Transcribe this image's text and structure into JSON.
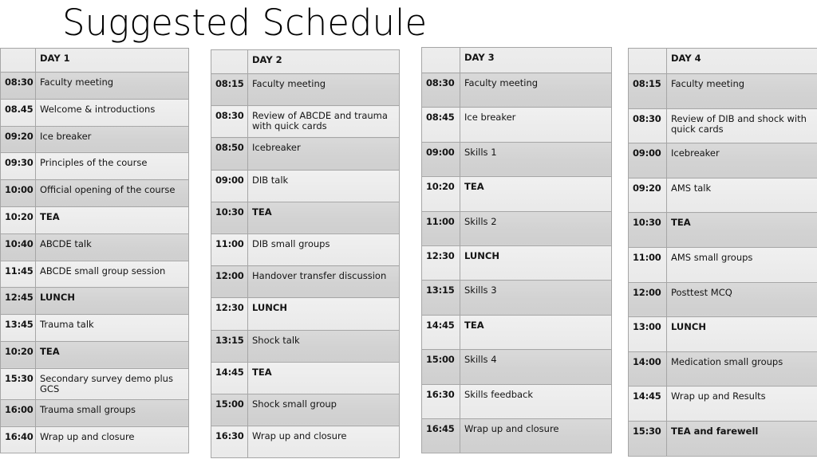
{
  "slide": {
    "title": "Suggested Schedule",
    "background_color": "#ffffff",
    "border_color": "#a6a6a6",
    "row_shade_dark": "#d9d9d9",
    "row_shade_light": "#f0f0f0"
  },
  "tables": [
    {
      "header_time": "",
      "header_day": "DAY 1",
      "rows": [
        {
          "time": "08:30",
          "activity": "Faculty meeting",
          "bold": false
        },
        {
          "time": "08.45",
          "activity": "Welcome & introductions",
          "bold": false
        },
        {
          "time": "09:20",
          "activity": "Ice breaker",
          "bold": false
        },
        {
          "time": "09:30",
          "activity": "Principles of the course",
          "bold": false
        },
        {
          "time": "10:00",
          "activity": "Official opening of the course",
          "bold": false
        },
        {
          "time": "10:20",
          "activity": "TEA",
          "bold": true
        },
        {
          "time": "10:40",
          "activity": "ABCDE talk",
          "bold": false
        },
        {
          "time": "11:45",
          "activity": "ABCDE small group session",
          "bold": false
        },
        {
          "time": "12:45",
          "activity": "LUNCH",
          "bold": true
        },
        {
          "time": "13:45",
          "activity": "Trauma talk",
          "bold": false
        },
        {
          "time": "10:20",
          "activity": "TEA",
          "bold": true
        },
        {
          "time": "15:30",
          "activity": "Secondary survey demo plus GCS",
          "bold": false
        },
        {
          "time": "16:00",
          "activity": "Trauma small groups",
          "bold": false
        },
        {
          "time": "16:40",
          "activity": "Wrap up and closure",
          "bold": false
        }
      ]
    },
    {
      "header_time": "",
      "header_day": "DAY 2",
      "rows": [
        {
          "time": "08:15",
          "activity": "Faculty meeting",
          "bold": false
        },
        {
          "time": "08:30",
          "activity": "Review of ABCDE and trauma with quick cards",
          "bold": false
        },
        {
          "time": "08:50",
          "activity": "Icebreaker",
          "bold": false
        },
        {
          "time": "09:00",
          "activity": "DIB talk",
          "bold": false
        },
        {
          "time": "10:30",
          "activity": "TEA",
          "bold": true
        },
        {
          "time": "11:00",
          "activity": "DIB small groups",
          "bold": false
        },
        {
          "time": "12:00",
          "activity": "Handover transfer discussion",
          "bold": false
        },
        {
          "time": "12:30",
          "activity": "LUNCH",
          "bold": true
        },
        {
          "time": "13:15",
          "activity": "Shock talk",
          "bold": false
        },
        {
          "time": "14:45",
          "activity": "TEA",
          "bold": true
        },
        {
          "time": "15:00",
          "activity": "Shock small group",
          "bold": false
        },
        {
          "time": "16:30",
          "activity": "Wrap up and closure",
          "bold": false
        }
      ]
    },
    {
      "header_time": "",
      "header_day": "DAY 3",
      "rows": [
        {
          "time": "08:30",
          "activity": "Faculty meeting",
          "bold": false
        },
        {
          "time": "08:45",
          "activity": "Ice breaker",
          "bold": false
        },
        {
          "time": "09:00",
          "activity": "Skills 1",
          "bold": false
        },
        {
          "time": "10:20",
          "activity": "TEA",
          "bold": true
        },
        {
          "time": "11:00",
          "activity": "Skills 2",
          "bold": false
        },
        {
          "time": "12:30",
          "activity": "LUNCH",
          "bold": true
        },
        {
          "time": "13:15",
          "activity": "Skills 3",
          "bold": false
        },
        {
          "time": "14:45",
          "activity": "TEA",
          "bold": true
        },
        {
          "time": "15:00",
          "activity": "Skills 4",
          "bold": false
        },
        {
          "time": "16:30",
          "activity": "Skills feedback",
          "bold": false
        },
        {
          "time": "16:45",
          "activity": "Wrap up and closure",
          "bold": false
        }
      ]
    },
    {
      "header_time": "",
      "header_day": "DAY 4",
      "rows": [
        {
          "time": "08:15",
          "activity": "Faculty meeting",
          "bold": false
        },
        {
          "time": "08:30",
          "activity": "Review of DIB and shock with quick cards",
          "bold": false
        },
        {
          "time": "09:00",
          "activity": "Icebreaker",
          "bold": false
        },
        {
          "time": "09:20",
          "activity": "AMS talk",
          "bold": false
        },
        {
          "time": "10:30",
          "activity": "TEA",
          "bold": true
        },
        {
          "time": "11:00",
          "activity": "AMS small groups",
          "bold": false
        },
        {
          "time": "12:00",
          "activity": "Posttest MCQ",
          "bold": false
        },
        {
          "time": "13:00",
          "activity": "LUNCH",
          "bold": true
        },
        {
          "time": "14:00",
          "activity": "Medication small groups",
          "bold": false
        },
        {
          "time": "14:45",
          "activity": "Wrap up and Results",
          "bold": false
        },
        {
          "time": "15:30",
          "activity": "TEA and farewell",
          "bold": true
        }
      ]
    }
  ]
}
